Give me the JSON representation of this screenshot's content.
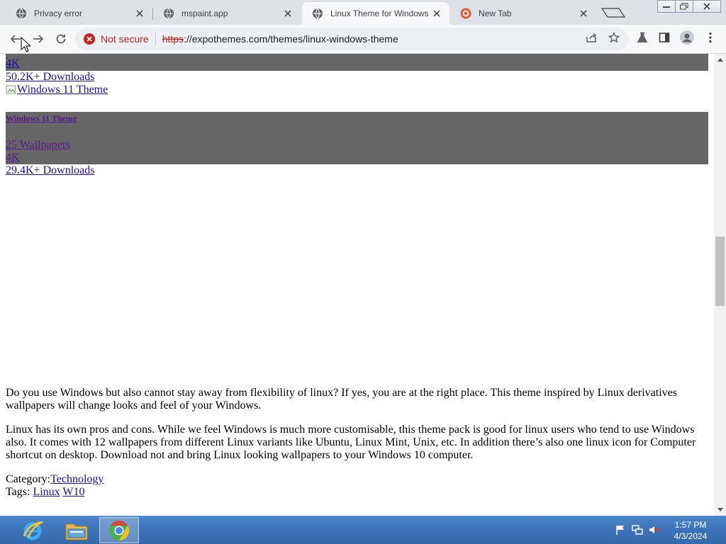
{
  "browser": {
    "tabs": [
      {
        "title": "Privacy error",
        "favicon": "globe-icon",
        "active": false
      },
      {
        "title": "mspaint.app",
        "favicon": "globe-icon",
        "active": false
      },
      {
        "title": "Linux Theme for Windows",
        "favicon": "globe-icon",
        "active": true
      },
      {
        "title": "New Tab",
        "favicon": "duckduckgo-icon",
        "active": false
      }
    ],
    "toolbar": {
      "security_label": "Not secure",
      "url_scheme": "https",
      "url_rest": "://expothemes.com/themes/linux-windows-theme"
    }
  },
  "page": {
    "prev_card": {
      "res_label": "4K",
      "downloads": "50.2K+ Downloads"
    },
    "card": {
      "image_alt": "Windows 11 Theme",
      "title": "Windows 11 Theme",
      "wallpapers": "25 Wallpapers",
      "res_label": "4K",
      "downloads": "29.4K+ Downloads"
    },
    "description": [
      "Do you use Windows but also cannot stay away from flexibility of linux? If yes, you are at the right place. This theme inspired by Linux derivatives wallpapers will change looks and feel of your Windows.",
      "Linux has its own pros and cons. While we feel Windows is much more customisable, this theme pack is good for linux users who tend to use Windows also. It comes with 12 wallpapers from different Linux variants like Ubuntu, Linux Mint, Unix, etc. In addition there’s also one linux icon for Computer shortcut on desktop. Download not and bring Linux looking wallpapers to your Windows 10 computer."
    ],
    "category_label": "Category:",
    "category_link": "Technology",
    "tags_label": "Tags:",
    "tags": [
      "Linux",
      "W10"
    ]
  },
  "taskbar": {
    "apps": [
      "internet-explorer-icon",
      "file-explorer-icon",
      "chrome-icon"
    ],
    "clock_time": "1:57 PM",
    "clock_date": "4/3/2024"
  },
  "colors": {
    "link": "#1a0dab",
    "band": "#666666",
    "not_secure": "#c5221f"
  }
}
